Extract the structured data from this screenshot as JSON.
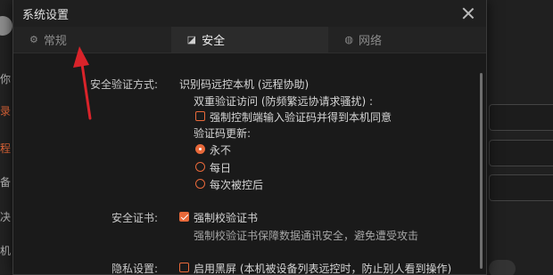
{
  "background_app": {
    "left_items": [
      "你",
      "录",
      "程",
      "备",
      "决",
      "机"
    ]
  },
  "dialog": {
    "title": "系统设置",
    "tabs": [
      {
        "label": "常规",
        "icon": "gear-icon",
        "active": false
      },
      {
        "label": "安全",
        "icon": "shield-icon",
        "active": true
      },
      {
        "label": "网络",
        "icon": "globe-icon",
        "active": false
      }
    ],
    "security_verification": {
      "label": "安全验证方式:",
      "mode": "识别码远控本机 (远程协助)",
      "dual_verification": "双重验证访问 (防频繁远协请求骚扰) :",
      "force_code_checkbox": {
        "label": "强制控制端输入验证码并得到本机同意",
        "checked": false
      },
      "code_update_label": "验证码更新:",
      "code_update_options": [
        {
          "label": "永不",
          "selected": true
        },
        {
          "label": "每日",
          "selected": false
        },
        {
          "label": "每次被控后",
          "selected": false
        }
      ]
    },
    "security_certificate": {
      "label": "安全证书:",
      "checkbox": {
        "label": "强制校验证书",
        "checked": true
      },
      "description": "强制校验证书保障数据通讯安全，避免遭受攻击"
    },
    "privacy": {
      "label": "隐私设置:",
      "checkbox": {
        "label": "启用黑屏 (本机被设备列表远控时，防止别人看到操作)",
        "checked": false
      }
    }
  },
  "colors": {
    "accent": "#e8693a",
    "annotation": "#d9232a",
    "dialog_bg": "#1a1a1a",
    "tab_active_bg": "#2b2b2b"
  }
}
